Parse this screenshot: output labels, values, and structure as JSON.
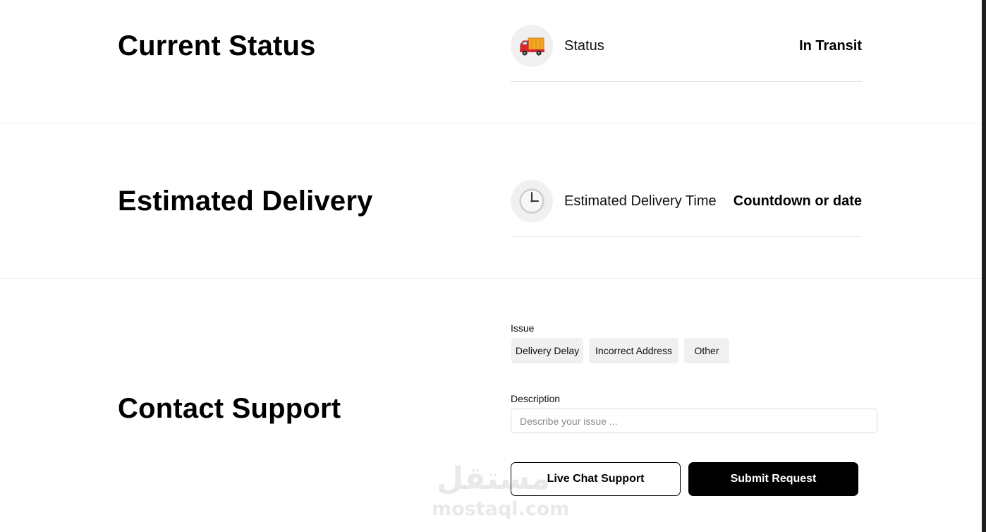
{
  "current_status": {
    "title": "Current Status",
    "icon": "delivery-truck-icon",
    "label": "Status",
    "value": "In Transit"
  },
  "estimated_delivery": {
    "title": "Estimated Delivery",
    "icon": "clock-icon",
    "label": "Estimated Delivery Time",
    "value": "Countdown or date"
  },
  "contact_support": {
    "title": "Contact Support",
    "issue_label": "Issue",
    "issue_options": [
      "Delivery Delay",
      "Incorrect Address",
      "Other"
    ],
    "description_label": "Description",
    "description_placeholder": "Describe your issue ...",
    "description_value": "",
    "live_chat_label": "Live Chat Support",
    "submit_label": "Submit Request"
  },
  "watermark": {
    "arabic": "مستقل",
    "latin": "mostaql.com"
  },
  "colors": {
    "primary_button": "#000000",
    "chip_background": "#f0f0f0",
    "icon_circle": "#f0f0f0",
    "divider": "#efefef"
  }
}
